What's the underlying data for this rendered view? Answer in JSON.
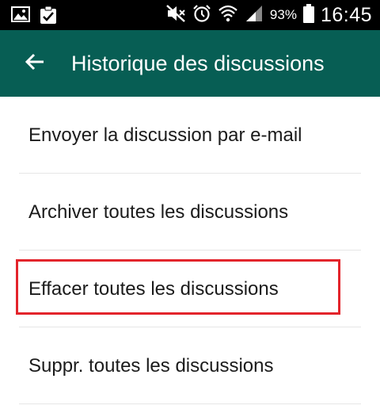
{
  "status_bar": {
    "left_icons": [
      "image-icon",
      "clipboard-check-icon"
    ],
    "right_icons": [
      "mute-icon",
      "alarm-icon",
      "wifi-icon",
      "signal-icon",
      "battery-icon"
    ],
    "battery_percent": "93%",
    "time": "16:45"
  },
  "toolbar": {
    "title": "Historique des discussions",
    "back_icon": "arrow-left-icon",
    "color": "#075e54"
  },
  "menu": {
    "items": [
      {
        "label": "Envoyer la discussion par e-mail"
      },
      {
        "label": "Archiver toutes les discussions"
      },
      {
        "label": "Effacer toutes les discussions"
      },
      {
        "label": "Suppr. toutes les discussions"
      }
    ]
  },
  "highlight_color": "#e3242b"
}
